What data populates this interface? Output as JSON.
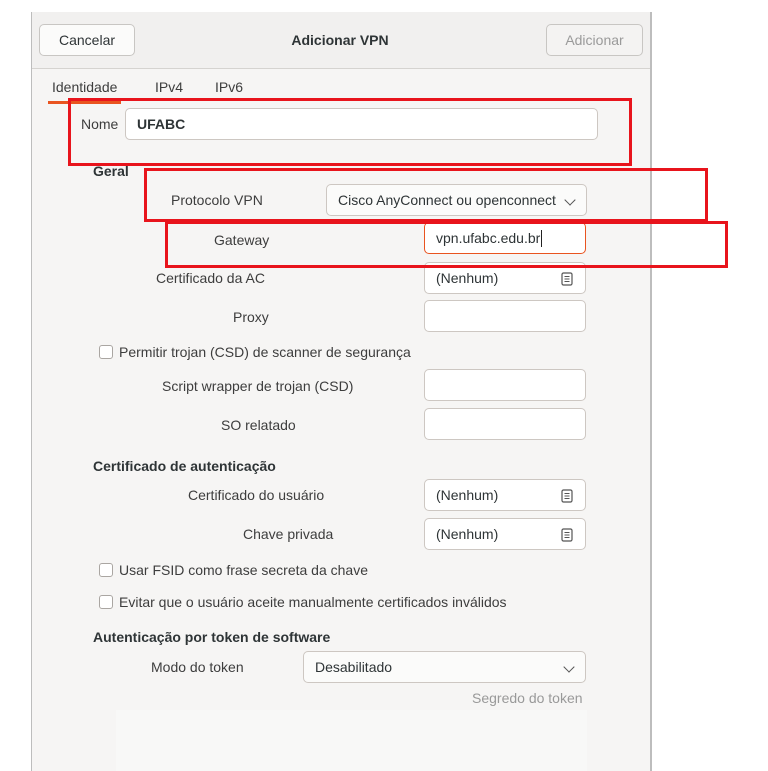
{
  "window": {
    "title": "Adicionar VPN",
    "cancel_label": "Cancelar",
    "add_label": "Adicionar"
  },
  "tabs": [
    {
      "label": "Identidade",
      "active": true
    },
    {
      "label": "IPv4",
      "active": false
    },
    {
      "label": "IPv6",
      "active": false
    }
  ],
  "name": {
    "label": "Nome",
    "value": "UFABC"
  },
  "general": {
    "section_title": "Geral",
    "protocol": {
      "label": "Protocolo VPN",
      "value": "Cisco AnyConnect ou openconnect"
    },
    "gateway": {
      "label": "Gateway",
      "value": "vpn.ufabc.edu.br"
    },
    "ca_cert": {
      "label": "Certificado da AC",
      "value": "(Nenhum)"
    },
    "proxy": {
      "label": "Proxy",
      "value": ""
    },
    "csd_check": {
      "label": "Permitir trojan (CSD) de scanner de segurança",
      "checked": false
    },
    "csd_wrapper": {
      "label": "Script wrapper de trojan (CSD)",
      "value": ""
    },
    "reported_os": {
      "label": "SO relatado",
      "value": ""
    }
  },
  "auth_cert": {
    "section_title": "Certificado de autenticação",
    "user_cert": {
      "label": "Certificado do usuário",
      "value": "(Nenhum)"
    },
    "private_key": {
      "label": "Chave privada",
      "value": "(Nenhum)"
    },
    "fsid_check": {
      "label": "Usar FSID como frase secreta da chave",
      "checked": false
    },
    "invalid_check": {
      "label": "Evitar que o usuário aceite manualmente certificados inválidos",
      "checked": false
    }
  },
  "token": {
    "section_title": "Autenticação por token de software",
    "mode": {
      "label": "Modo do token",
      "value": "Desabilitado"
    },
    "secret_label": "Segredo do token"
  },
  "icons": {
    "file_chooser": "document-open-icon",
    "dropdown": "chevron-down-icon"
  },
  "colors": {
    "accent": "#e95420",
    "annotation_box": "#e8141c"
  }
}
